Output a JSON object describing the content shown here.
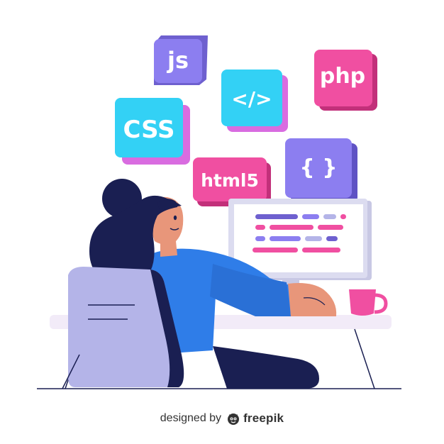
{
  "chips": {
    "js": "js",
    "tag": "</>",
    "php": "php",
    "css": "CSS",
    "html5": "html5",
    "braces": "{ }"
  },
  "colors": {
    "purple": "#8c7ef0",
    "cyan": "#33d1f5",
    "pink": "#f04fa1",
    "navy": "#1a1f52",
    "blue": "#2f7de8",
    "chair": "#b4b4e8",
    "desk": "#f2ebf8",
    "monitor_frame": "#dcdcf0",
    "cup": "#f04fa1"
  },
  "icons": {
    "footer_logo": "freepik-logo-icon"
  },
  "footer": {
    "prefix": "designed by",
    "brand": "freepik"
  }
}
